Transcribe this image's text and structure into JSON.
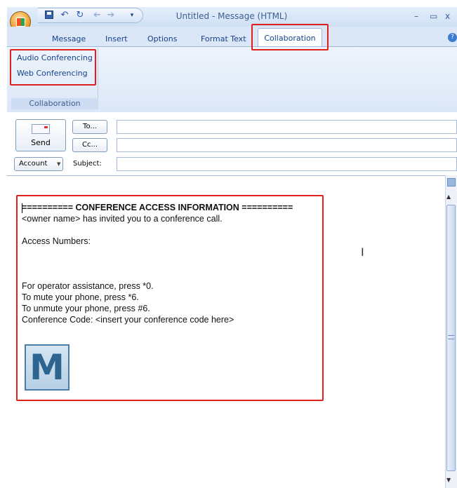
{
  "window": {
    "title": "Untitled - Message (HTML)",
    "controls": {
      "minimize": "–",
      "maximize": "▭",
      "close": "x"
    }
  },
  "quick_access": {
    "icons": [
      "save-icon",
      "undo-icon",
      "redo-icon",
      "previous-icon",
      "next-icon",
      "customize-icon"
    ],
    "undo_glyph": "↶",
    "redo_glyph": "↻",
    "prev_glyph": "➔",
    "next_glyph": "➔",
    "customize_glyph": "▾"
  },
  "tabs": [
    {
      "label": "Message",
      "active": false
    },
    {
      "label": "Insert",
      "active": false
    },
    {
      "label": "Options",
      "active": false
    },
    {
      "label": "Format Text",
      "active": false
    },
    {
      "label": "Collaboration",
      "active": true
    }
  ],
  "help_glyph": "?",
  "ribbon": {
    "group_label": "Collaboration",
    "buttons": [
      "Audio Conferencing",
      "Web Conferencing"
    ]
  },
  "header": {
    "send_label": "Send",
    "to_label": "To...",
    "cc_label": "Cc...",
    "account_label": "Account",
    "account_arrow": "▼",
    "subject_label": "Subject:",
    "to_value": "",
    "cc_value": "",
    "subject_value": ""
  },
  "body": {
    "lines": [
      "========== CONFERENCE ACCESS INFORMATION ==========",
      "<owner name> has invited you to a conference call.",
      "",
      "Access Numbers:",
      "",
      "",
      "",
      "For operator assistance, press *0.",
      "To mute your phone, press *6.",
      "To unmute your phone, press #6.",
      "Conference Code: <insert your conference code here>"
    ],
    "logo_letter": "M",
    "cursor_glyph": "I"
  },
  "scrollbar": {
    "up_glyph": "▲",
    "down_glyph": "▼"
  },
  "colors": {
    "highlight": "#e0201c",
    "ribbon": "#dbe7f7",
    "accent_text": "#15428b"
  }
}
